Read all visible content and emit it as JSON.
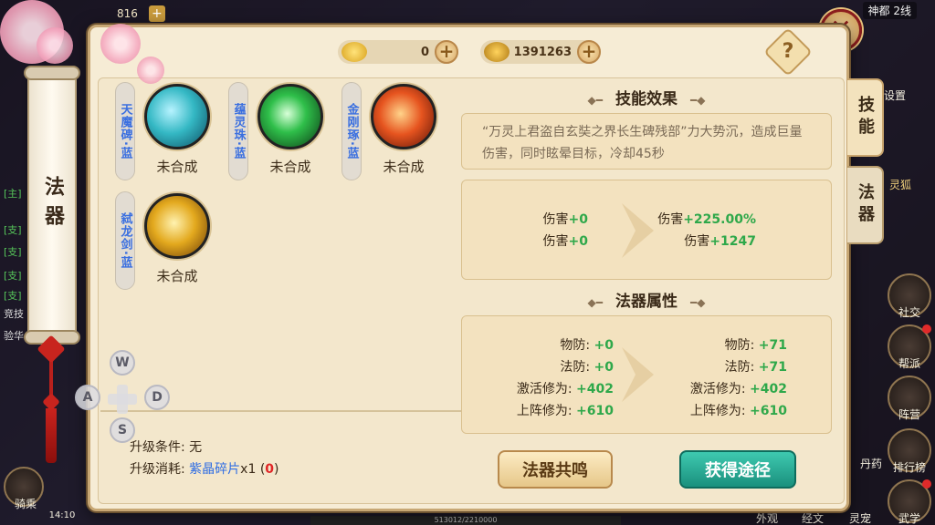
{
  "topbar": {
    "value_left": "816",
    "plus": "+"
  },
  "map": {
    "name": "神都 2线"
  },
  "background_chat": [
    "[主]",
    "[支]",
    "[支]",
    "[支]",
    "[支]",
    "竞技",
    "验华"
  ],
  "hud_right": [
    {
      "label": "社交",
      "icon": "social-icon"
    },
    {
      "label": "帮派",
      "icon": "guild-icon"
    },
    {
      "label": "阵营",
      "icon": "camp-icon"
    },
    {
      "label": "排行榜",
      "icon": "ranking-icon"
    },
    {
      "label": "武学",
      "icon": "martial-icon"
    }
  ],
  "hud_bottom": [
    "外观",
    "经文",
    "灵宠",
    "丹药"
  ],
  "hud_left_bottom": "骑乘",
  "hud_misc": {
    "settings": "设置",
    "spirit_fox": "灵狐",
    "clock": "14:10"
  },
  "panel": {
    "vertical_title": "法器",
    "currency": [
      {
        "icon": "gold-ingot-icon",
        "value": "0"
      },
      {
        "icon": "coin-icon",
        "value": "1391263"
      }
    ],
    "help_label": "?",
    "close_label": "✕",
    "tabs": [
      {
        "label": "技能",
        "active": true
      },
      {
        "label": "法器",
        "active": false
      }
    ]
  },
  "artifacts": [
    {
      "name": "天魔碑·蓝",
      "status": "未合成",
      "color": "#34b8c4"
    },
    {
      "name": "蕴灵珠·蓝",
      "status": "未合成",
      "color": "#2fbf4a"
    },
    {
      "name": "金刚琢·蓝",
      "status": "未合成",
      "color": "#e6541f"
    },
    {
      "name": "弑龙剑·蓝",
      "status": "未合成",
      "color": "#e3a91e"
    }
  ],
  "upgrade": {
    "condition_label": "升级条件:",
    "condition_value": "无",
    "cost_label": "升级消耗:",
    "cost_item": "紫晶碎片",
    "cost_qty": "x1",
    "cost_have_open": "(",
    "cost_have": "0",
    "cost_have_close": ")"
  },
  "skill": {
    "title": "技能效果",
    "description": "“万灵上君盗自玄奘之界长生碑残部”力大势沉，造成巨量伤害，同时眩晕目标，冷却45秒",
    "left": [
      {
        "label": "伤害",
        "value": "+0"
      },
      {
        "label": "伤害",
        "value": "+0"
      }
    ],
    "right": [
      {
        "label": "伤害",
        "value": "+225.00%"
      },
      {
        "label": "伤害",
        "value": "+1247"
      }
    ]
  },
  "attributes": {
    "title": "法器属性",
    "left": [
      {
        "label": "物防:",
        "value": "+0"
      },
      {
        "label": "法防:",
        "value": "+0"
      },
      {
        "label": "激活修为:",
        "value": "+402"
      },
      {
        "label": "上阵修为:",
        "value": "+610"
      }
    ],
    "right": [
      {
        "label": "物防:",
        "value": "+71"
      },
      {
        "label": "法防:",
        "value": "+71"
      },
      {
        "label": "激活修为:",
        "value": "+402"
      },
      {
        "label": "上阵修为:",
        "value": "+610"
      }
    ]
  },
  "buttons": {
    "resonance": "法器共鸣",
    "obtain": "获得途径"
  },
  "pad": {
    "up": "W",
    "left": "A",
    "right": "D",
    "down": "S"
  },
  "exp_bar": "513012/2210000",
  "colors": {
    "green": "#2ea84a",
    "blue": "#2f6de3",
    "red": "#e02525",
    "teal": "#1a907d"
  }
}
